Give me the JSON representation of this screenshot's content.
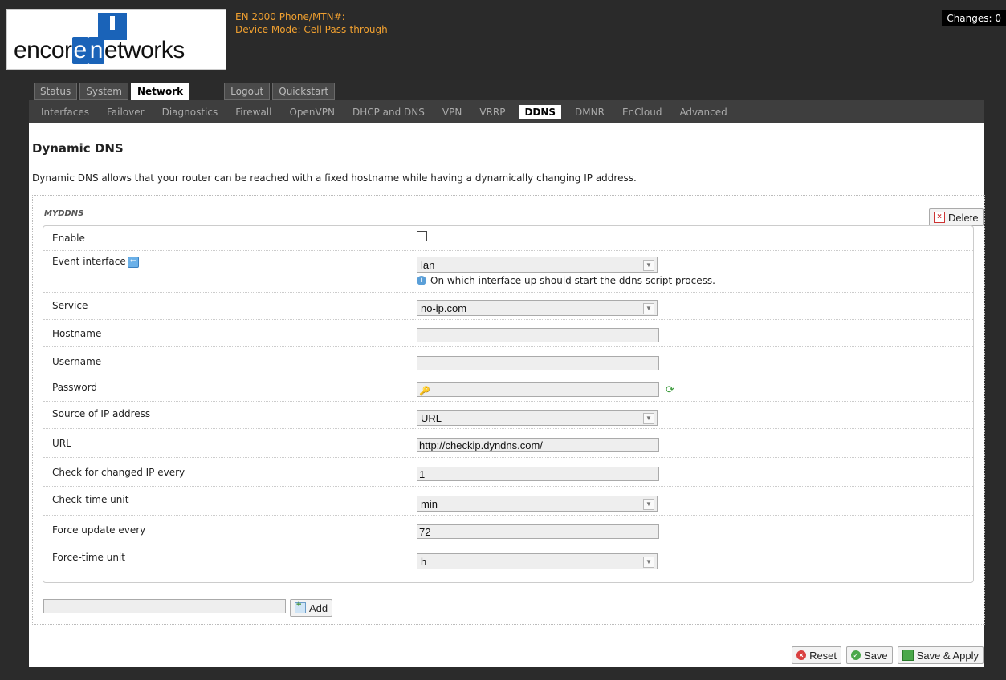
{
  "logo": {
    "text_before": "encor",
    "text_highlight": "e",
    "text_middle": "n",
    "text_after": "etworks"
  },
  "device": {
    "phone_line": "EN 2000 Phone/MTN#:",
    "mode_line": "Device Mode: Cell Pass-through"
  },
  "changes": "Changes: 0",
  "top_nav": [
    {
      "label": "Status"
    },
    {
      "label": "System"
    },
    {
      "label": "Network",
      "active": true
    },
    {
      "label": "Logout"
    },
    {
      "label": "Quickstart"
    }
  ],
  "sub_nav": [
    {
      "label": "Interfaces"
    },
    {
      "label": "Failover"
    },
    {
      "label": "Diagnostics"
    },
    {
      "label": "Firewall"
    },
    {
      "label": "OpenVPN"
    },
    {
      "label": "DHCP and DNS"
    },
    {
      "label": "VPN"
    },
    {
      "label": "VRRP"
    },
    {
      "label": "DDNS",
      "active": true
    },
    {
      "label": "DMNR"
    },
    {
      "label": "EnCloud"
    },
    {
      "label": "Advanced"
    }
  ],
  "page": {
    "title": "Dynamic DNS",
    "description": "Dynamic DNS allows that your router can be reached with a fixed hostname while having a dynamically changing IP address."
  },
  "section": {
    "name": "MYDDNS",
    "delete_label": "Delete",
    "fields": {
      "enable": {
        "label": "Enable",
        "checked": false
      },
      "event_interface": {
        "label": "Event interface",
        "value": "lan",
        "hint": "On which interface up should start the ddns script process."
      },
      "service": {
        "label": "Service",
        "value": "no-ip.com"
      },
      "hostname": {
        "label": "Hostname",
        "value": ""
      },
      "username": {
        "label": "Username",
        "value": ""
      },
      "password": {
        "label": "Password",
        "value": ""
      },
      "source": {
        "label": "Source of IP address",
        "value": "URL"
      },
      "url": {
        "label": "URL",
        "value": "http://checkip.dyndns.com/"
      },
      "check_every": {
        "label": "Check for changed IP every",
        "value": "1"
      },
      "check_unit": {
        "label": "Check-time unit",
        "value": "min"
      },
      "force_every": {
        "label": "Force update every",
        "value": "72"
      },
      "force_unit": {
        "label": "Force-time unit",
        "value": "h"
      }
    },
    "add_label": "Add"
  },
  "footer": {
    "reset_label": "Reset",
    "save_label": "Save",
    "save_apply_label": "Save & Apply"
  },
  "icons": {
    "delete": "delete-icon",
    "interface": "interface-icon",
    "info": "info-icon",
    "key": "key-icon",
    "refresh": "refresh-icon",
    "add": "add-icon",
    "reset": "reset-icon",
    "save": "save-icon",
    "apply": "apply-icon"
  },
  "colors": {
    "accent": "#f0a030",
    "header_bg": "#2a2a2a",
    "logo_blue": "#1a63b8"
  }
}
